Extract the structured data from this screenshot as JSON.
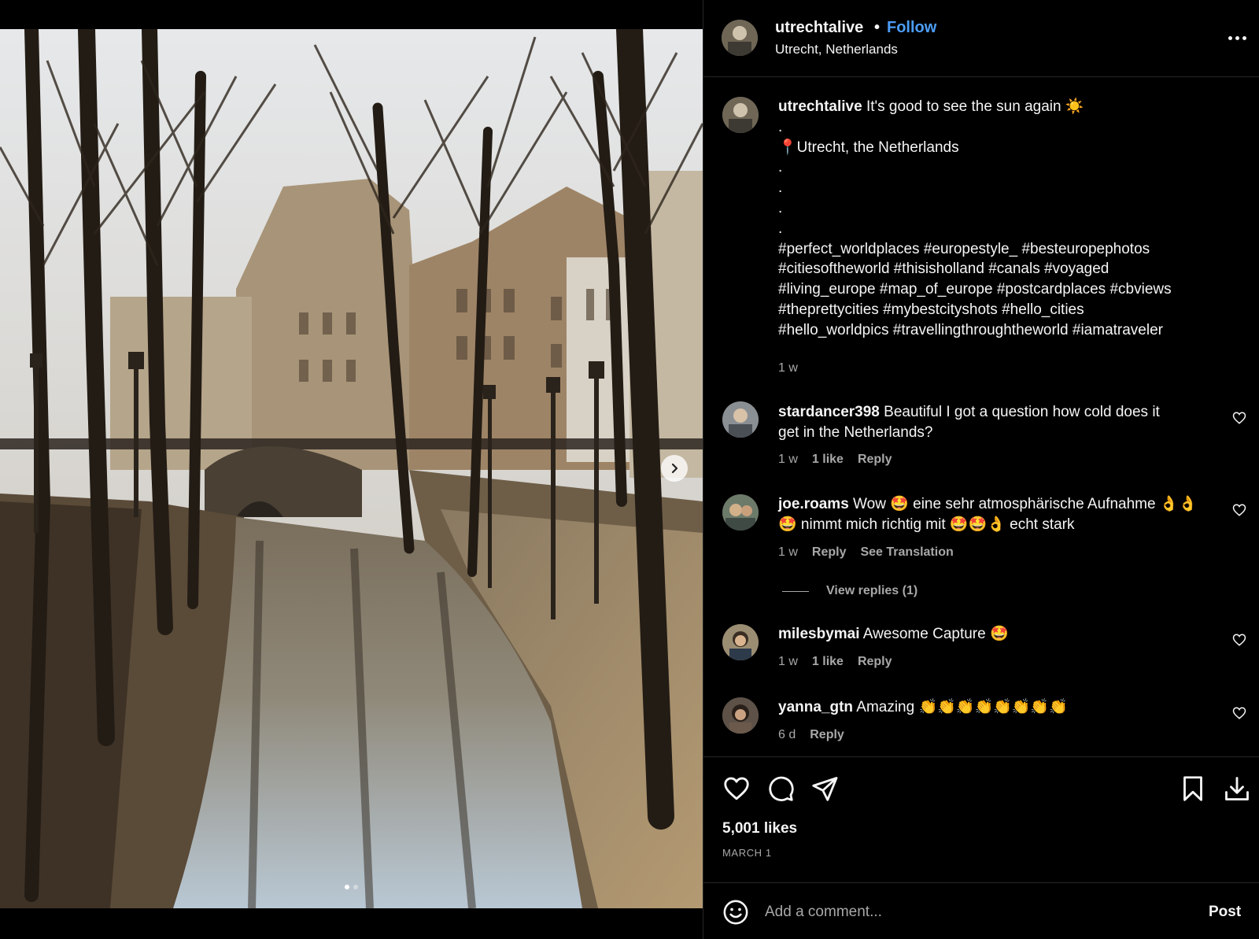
{
  "post": {
    "username": "utrechtalive",
    "separator": "•",
    "follow_label": "Follow",
    "location": "Utrecht, Netherlands",
    "more_icon": "more-options-icon"
  },
  "caption": {
    "username": "utrechtalive",
    "lines": [
      "It's good to see the sun again ☀️",
      ".",
      "📍Utrecht, the Netherlands",
      ".",
      ".",
      ".",
      ".",
      "#perfect_worldplaces #europestyle_ #besteuropephotos",
      "#citiesoftheworld #thisisholland #canals #voyaged",
      "#living_europe #map_of_europe #postcardplaces #cbviews",
      "#theprettycities #mybestcityshots #hello_cities",
      "#hello_worldpics #travellingthroughtheworld #iamatraveler"
    ],
    "time": "1 w"
  },
  "comments": [
    {
      "username": "stardancer398",
      "text_line1": "Beautiful I got a question how cold does it",
      "text_line2": "get in the Netherlands?",
      "time": "1 w",
      "likes": "1 like",
      "reply": "Reply"
    },
    {
      "username": "joe.roams",
      "text_line1": "Wow 🤩 eine sehr atmosphärische Aufnahme 👌👌",
      "text_line2": "🤩 nimmt mich richtig mit 🤩🤩👌 echt stark",
      "time": "1 w",
      "reply": "Reply",
      "translate": "See Translation",
      "view_replies": "View replies (1)"
    },
    {
      "username": "milesbymai",
      "text_line1": "Awesome Capture 🤩",
      "time": "1 w",
      "likes": "1 like",
      "reply": "Reply"
    },
    {
      "username": "yanna_gtn",
      "text_line1": "Amazing 👏👏👏👏👏👏👏👏",
      "time": "6 d",
      "reply": "Reply"
    }
  ],
  "actions": {
    "likes": "5,001 likes",
    "date": "MARCH 1"
  },
  "add_comment": {
    "placeholder": "Add a comment...",
    "post_label": "Post"
  },
  "colors": {
    "background": "#000000",
    "link_blue": "#4c9df8",
    "secondary_text": "#a8a8a8",
    "divider": "#262626"
  }
}
